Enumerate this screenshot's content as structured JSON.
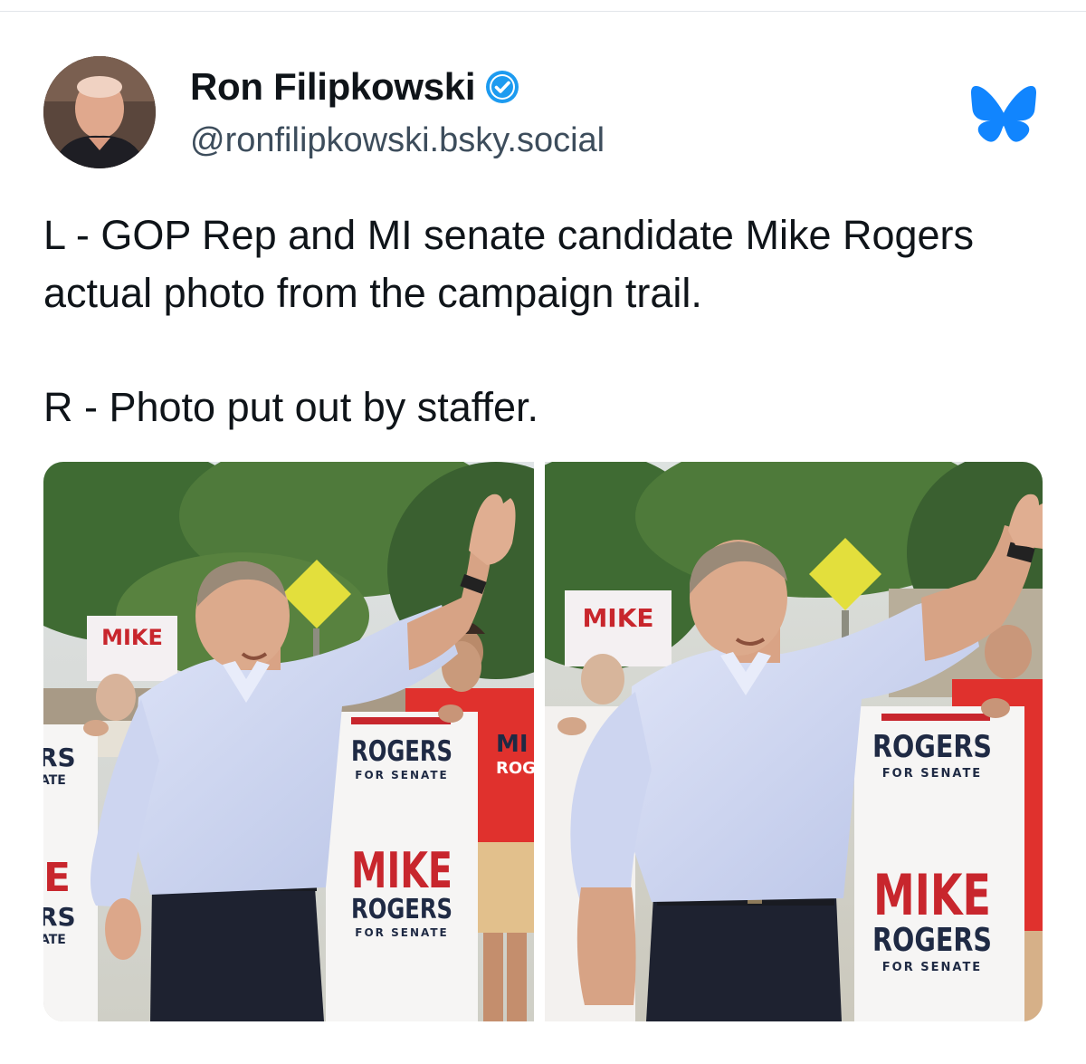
{
  "author": {
    "name": "Ron Filipkowski",
    "handle": "@ronfilipkowski.bsky.social",
    "verified": true,
    "avatar_icon": "avatar-photo"
  },
  "platform": {
    "icon": "bluesky-butterfly-icon",
    "color": "#1185fe"
  },
  "post": {
    "line1": "L - GOP Rep and MI senate candidate Mike Rogers actual photo from the campaign trail.",
    "line2": "R - Photo put out by staffer."
  },
  "images": {
    "left": {
      "signs": {
        "top_left_edge": "RS",
        "top_left_edge_sub": "ATE",
        "mid_left_edge": "E",
        "mid_left_edge2": "RS",
        "mid_left_edge_sub": "ATE",
        "rogers": "ROGERS",
        "for_senate": "FOR SENATE",
        "mike": "MIKE",
        "back_sign": "MIKE",
        "red_shirt": "MI",
        "red_shirt_sub": "ROG"
      }
    },
    "right": {
      "signs": {
        "rogers": "ROGERS",
        "for_senate": "FOR SENATE",
        "mike": "MIKE",
        "back_sign": "MIKE"
      }
    }
  },
  "colors": {
    "verified_badge": "#1d9bf0",
    "sign_navy": "#1f2a44",
    "sign_red": "#c8262d",
    "shirt": "#cfd6f0",
    "foliage": "#3f6b33"
  }
}
